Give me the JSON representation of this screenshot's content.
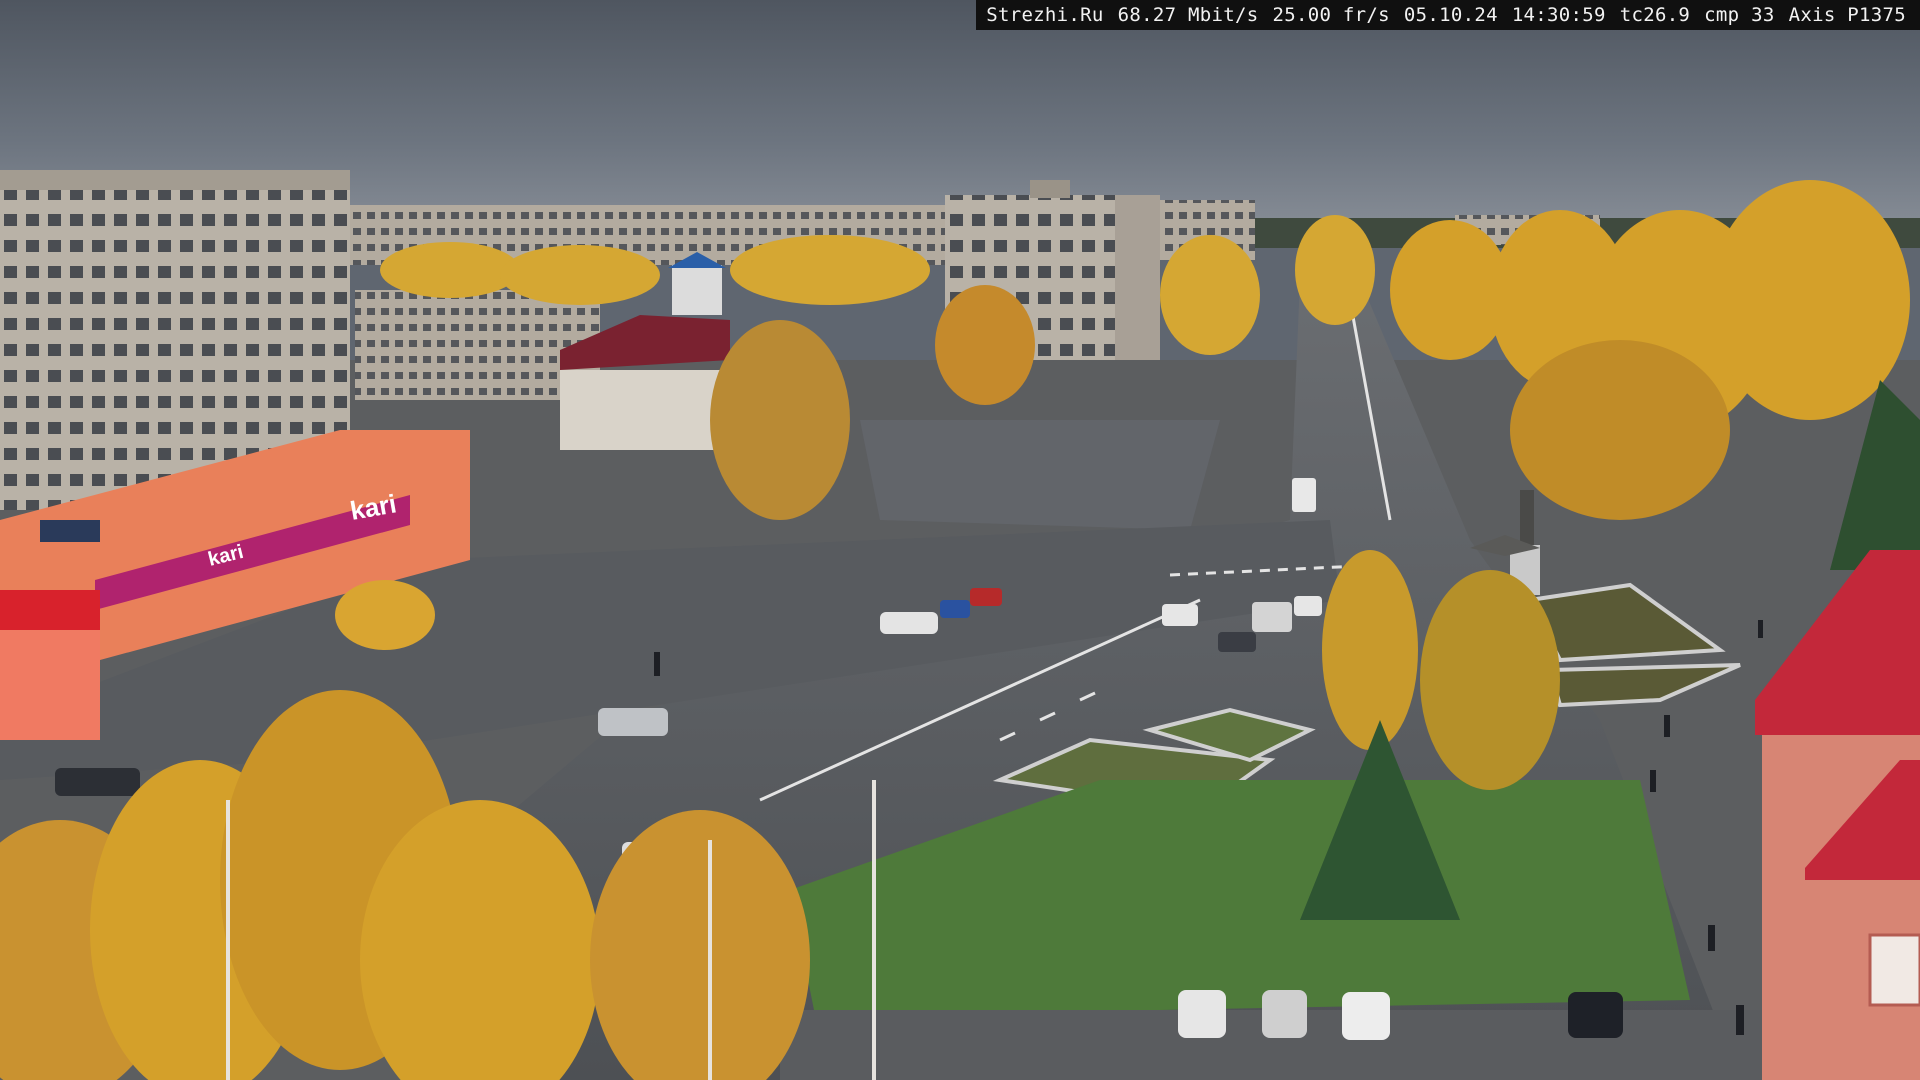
{
  "overlay": {
    "site": "Strezhi.Ru",
    "bitrate": "68.27 Mbit/s",
    "framerate": "25.00 fr/s",
    "date": "05.10.24",
    "time": "14:30:59",
    "tc": "tc26.9",
    "cmp": "cmp 33",
    "camera": "Axis P1375"
  },
  "signs": {
    "store_brand": "kari"
  },
  "colors": {
    "sky": "#6b737e",
    "asphalt": "#55585c",
    "grass": "#4e7a3a",
    "foliage_yellow": "#d4a02a",
    "store_facade": "#e9805a",
    "store_banner": "#b0236e",
    "overlay_bg": "#101010",
    "overlay_text": "#f2f2f2"
  }
}
